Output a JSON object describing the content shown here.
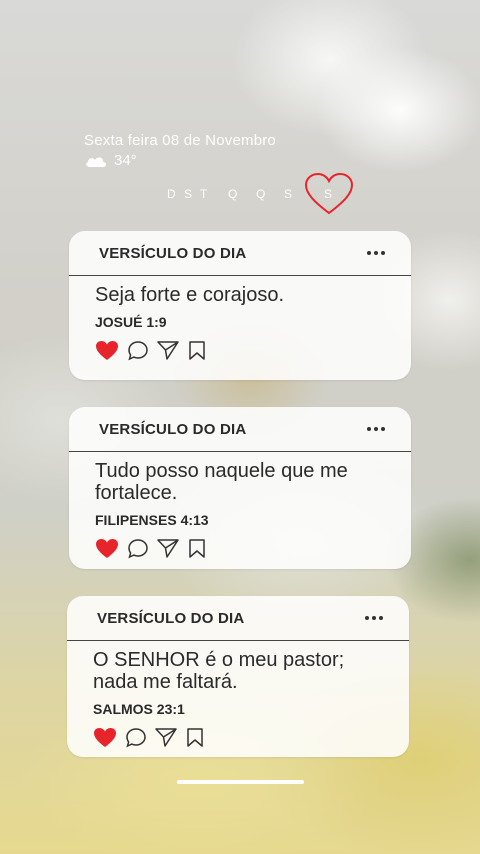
{
  "header": {
    "date": "Sexta feira 08 de Novembro",
    "temperature": "34°",
    "weather_icon": "cloud-icon"
  },
  "days": [
    "D",
    "S",
    "T",
    "Q",
    "Q",
    "S",
    "S"
  ],
  "colors": {
    "heart": "#e8242b",
    "card_bg": "#ffffff",
    "text": "#2a2a2a"
  },
  "cards": [
    {
      "title": "VERSÍCULO DO DIA",
      "verse": "Seja forte e corajoso.",
      "reference": "JOSUÉ 1:9"
    },
    {
      "title": "VERSÍCULO DO DIA",
      "verse": "Tudo posso naquele que me fortalece.",
      "reference": "FILIPENSES 4:13"
    },
    {
      "title": "VERSÍCULO DO DIA",
      "verse": "O SENHOR é o meu pastor; nada me faltará.",
      "reference": "SALMOS 23:1"
    }
  ]
}
